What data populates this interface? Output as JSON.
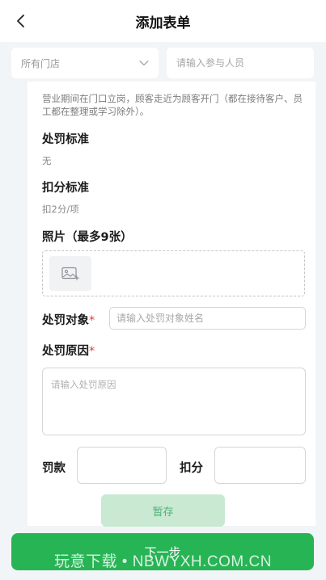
{
  "header": {
    "title": "添加表单",
    "back_icon": "chevron-left-icon"
  },
  "filters": {
    "store_select_value": "所有门店",
    "participant_placeholder": "请输入参与人员"
  },
  "form": {
    "description": "营业期间在门口立岗，顾客走近为顾客开门（都在接待客户、员工都在整理或学习除外）。",
    "penalty_standard_label": "处罚标准",
    "penalty_standard_value": "无",
    "deduction_standard_label": "扣分标准",
    "deduction_standard_value": "扣2分/项",
    "photo_label": "照片（最多9张）",
    "target_label": "处罚对象",
    "target_placeholder": "请输入处罚对象姓名",
    "reason_label": "处罚原因",
    "reason_placeholder": "请输入处罚原因",
    "fine_label": "罚款",
    "fine_value": "",
    "points_label": "扣分",
    "points_value": "",
    "required_mark": "*"
  },
  "actions": {
    "draft_label": "暂存",
    "next_label": "下一步"
  },
  "watermark": "玩意下载 • NBWYXH.COM.CN",
  "colors": {
    "primary": "#27b455",
    "draft_bg": "#c9e9d3",
    "required": "#e23b3b"
  }
}
